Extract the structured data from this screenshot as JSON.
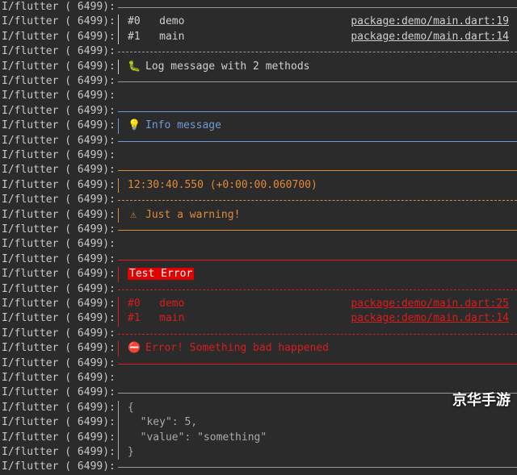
{
  "log_prefix": "I/flutter ( 6499):",
  "colors": {
    "verbose": "#cfcfcf",
    "info": "#6f9bd8",
    "warning": "#e08a3a",
    "error": "#d81d1d",
    "json": "#a9a9a9",
    "rule": "#9a9a9a"
  },
  "lines": [
    {
      "type": "rule",
      "style": "solid",
      "color": "#9a9a9a"
    },
    {
      "type": "stack",
      "frame": "#0",
      "method": "demo",
      "location": "package:demo/main.dart:19",
      "color": "#cfcfcf"
    },
    {
      "type": "stack",
      "frame": "#1",
      "method": "main",
      "location": "package:demo/main.dart:14",
      "color": "#cfcfcf"
    },
    {
      "type": "rule",
      "style": "dashed",
      "color": "#9a9a9a"
    },
    {
      "type": "message",
      "icon": "worm-icon",
      "glyph": "🐛",
      "text": "Log message with 2 methods",
      "color": "#cfcfcf"
    },
    {
      "type": "rule",
      "style": "solid",
      "color": "#9a9a9a"
    },
    {
      "type": "blank"
    },
    {
      "type": "rule",
      "style": "solid",
      "color": "#6f9bd8"
    },
    {
      "type": "message",
      "icon": "lightbulb-icon",
      "glyph": "💡",
      "text": "Info message",
      "color": "#6f9bd8"
    },
    {
      "type": "rule",
      "style": "solid",
      "color": "#6f9bd8"
    },
    {
      "type": "blank"
    },
    {
      "type": "rule",
      "style": "solid",
      "color": "#e08a3a"
    },
    {
      "type": "message",
      "icon": "",
      "glyph": "",
      "text": "12:30:40.550 (+0:00:00.060700)",
      "color": "#e08a3a"
    },
    {
      "type": "rule",
      "style": "dashed",
      "color": "#e08a3a"
    },
    {
      "type": "message",
      "icon": "warning-icon",
      "glyph": "⚠",
      "text": "Just a warning!",
      "color": "#e08a3a"
    },
    {
      "type": "rule",
      "style": "solid",
      "color": "#e08a3a"
    },
    {
      "type": "blank"
    },
    {
      "type": "rule",
      "style": "solid",
      "color": "#d81d1d"
    },
    {
      "type": "badge",
      "text": "Test Error",
      "color": "#d81d1d"
    },
    {
      "type": "rule",
      "style": "dashed",
      "color": "#d81d1d"
    },
    {
      "type": "stack",
      "frame": "#0",
      "method": "demo",
      "location": "package:demo/main.dart:25",
      "color": "#d81d1d"
    },
    {
      "type": "stack",
      "frame": "#1",
      "method": "main",
      "location": "package:demo/main.dart:14",
      "color": "#d81d1d"
    },
    {
      "type": "rule",
      "style": "dashed",
      "color": "#d81d1d"
    },
    {
      "type": "message",
      "icon": "no-entry-icon",
      "glyph": "⛔",
      "text": "Error! Something bad happened",
      "color": "#d81d1d"
    },
    {
      "type": "rule",
      "style": "solid",
      "color": "#d81d1d"
    },
    {
      "type": "blank"
    },
    {
      "type": "rule",
      "style": "solid",
      "color": "#9a9a9a"
    },
    {
      "type": "message",
      "icon": "",
      "glyph": "",
      "text": "{",
      "color": "#a9a9a9"
    },
    {
      "type": "message",
      "icon": "",
      "glyph": "",
      "text": "  \"key\": 5,",
      "color": "#a9a9a9"
    },
    {
      "type": "message",
      "icon": "",
      "glyph": "",
      "text": "  \"value\": \"something\"",
      "color": "#a9a9a9"
    },
    {
      "type": "message",
      "icon": "",
      "glyph": "",
      "text": "}",
      "color": "#a9a9a9"
    },
    {
      "type": "rule",
      "style": "solid",
      "color": "#9a9a9a"
    }
  ],
  "watermark": "京华手游"
}
